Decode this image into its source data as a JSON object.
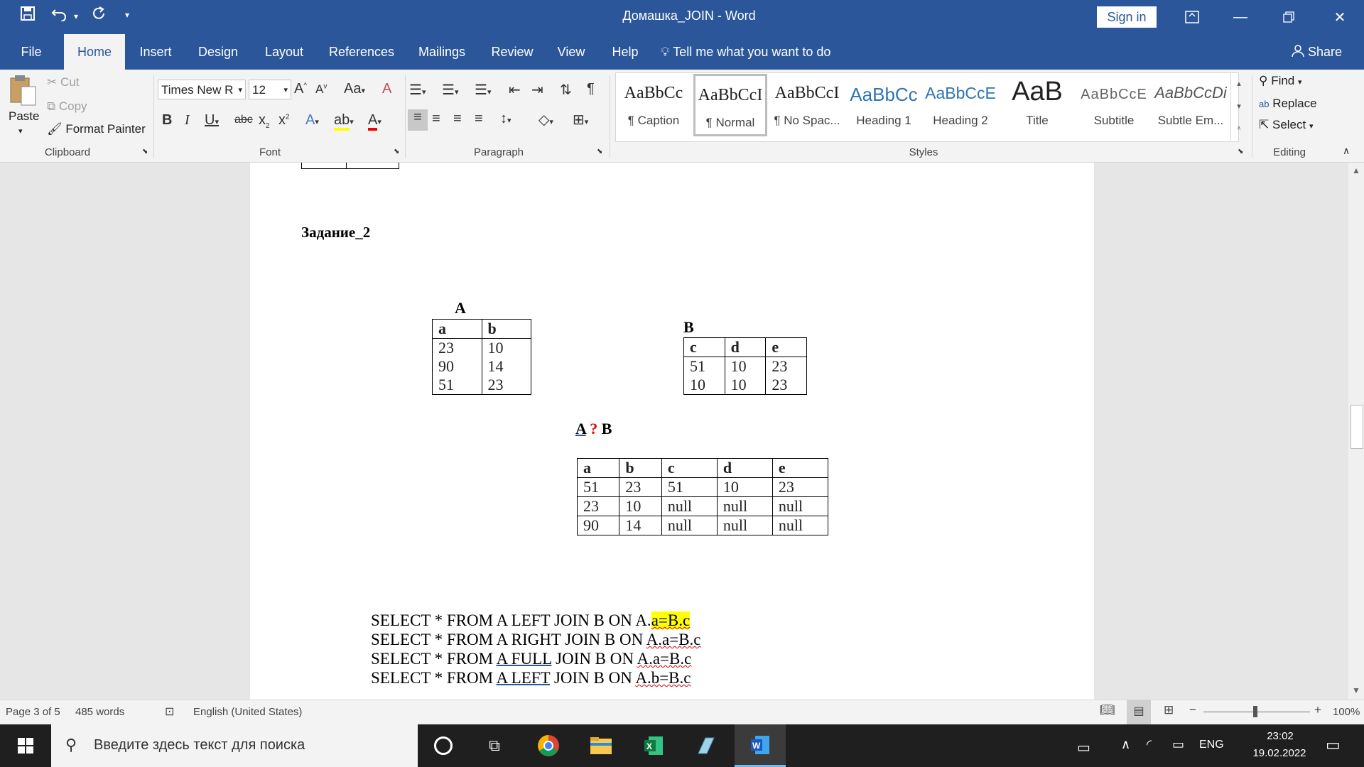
{
  "window": {
    "title": "Домашка_JOIN  -  Word",
    "sign_in": "Sign in",
    "share": "Share"
  },
  "tabs": [
    "File",
    "Home",
    "Insert",
    "Design",
    "Layout",
    "References",
    "Mailings",
    "Review",
    "View",
    "Help"
  ],
  "tell_me": "Tell me what you want to do",
  "clipboard": {
    "paste": "Paste",
    "cut": "Cut",
    "copy": "Copy",
    "format_painter": "Format Painter",
    "label": "Clipboard"
  },
  "font": {
    "name": "Times New R",
    "size": "12",
    "label": "Font"
  },
  "paragraph": {
    "label": "Paragraph"
  },
  "styles": {
    "label": "Styles",
    "items": [
      {
        "sample": "AaBbCc",
        "name": "¶ Caption"
      },
      {
        "sample": "AaBbCcI",
        "name": "¶ Normal"
      },
      {
        "sample": "AaBbCcI",
        "name": "¶ No Spac..."
      },
      {
        "sample": "AaBbCc",
        "name": "Heading 1"
      },
      {
        "sample": "AaBbCcE",
        "name": "Heading 2"
      },
      {
        "sample": "AaB",
        "name": "Title"
      },
      {
        "sample": "AaBbCcE",
        "name": "Subtitle"
      },
      {
        "sample": "AaBbCcDi",
        "name": "Subtle Em..."
      }
    ]
  },
  "editing": {
    "find": "Find",
    "replace": "Replace",
    "select": "Select",
    "label": "Editing"
  },
  "document": {
    "heading": "Задание_2",
    "table_a": {
      "title": "A",
      "headers": [
        "a",
        "b"
      ],
      "rows": [
        [
          "23",
          "10"
        ],
        [
          "90",
          "14"
        ],
        [
          "51",
          "23"
        ]
      ]
    },
    "table_b": {
      "title": "B",
      "headers": [
        "c",
        "d",
        "e"
      ],
      "rows": [
        [
          "51",
          "10",
          "23"
        ],
        [
          "10",
          "10",
          "23"
        ]
      ]
    },
    "join_label": {
      "left": "A",
      "op": "?",
      "right": "B"
    },
    "result": {
      "headers": [
        "a",
        "b",
        "c",
        "d",
        "e"
      ],
      "rows": [
        [
          "51",
          "23",
          "51",
          "10",
          "23"
        ],
        [
          "23",
          "10",
          "null",
          "null",
          "null"
        ],
        [
          "90",
          "14",
          "null",
          "null",
          "null"
        ]
      ]
    },
    "queries": [
      {
        "pre": "SELECT * FROM A LEFT JOIN B ON A.",
        "mark": "a=B.c"
      },
      {
        "pre": "SELECT * FROM A RIGHT JOIN B ON ",
        "mark": "A.a=B.c"
      },
      {
        "pre1": "SELECT * FROM ",
        "mark1": "A  FULL",
        "mid": " JOIN B ON ",
        "mark2": "A.a=B.c"
      },
      {
        "pre1": "SELECT * FROM ",
        "mark1": "A  LEFT",
        "mid": " JOIN B ON ",
        "mark2": "A.b=B.c"
      }
    ]
  },
  "status": {
    "page": "Page 3 of 5",
    "words": "485 words",
    "language": "English (United States)",
    "zoom": "100%"
  },
  "taskbar": {
    "search_placeholder": "Введите здесь текст для поиска",
    "lang": "ENG",
    "time": "23:02",
    "date": "19.02.2022"
  },
  "colors": {
    "word_blue": "#2b579a",
    "highlight": "#ffff00",
    "taskbar": "#1f1f1f"
  }
}
